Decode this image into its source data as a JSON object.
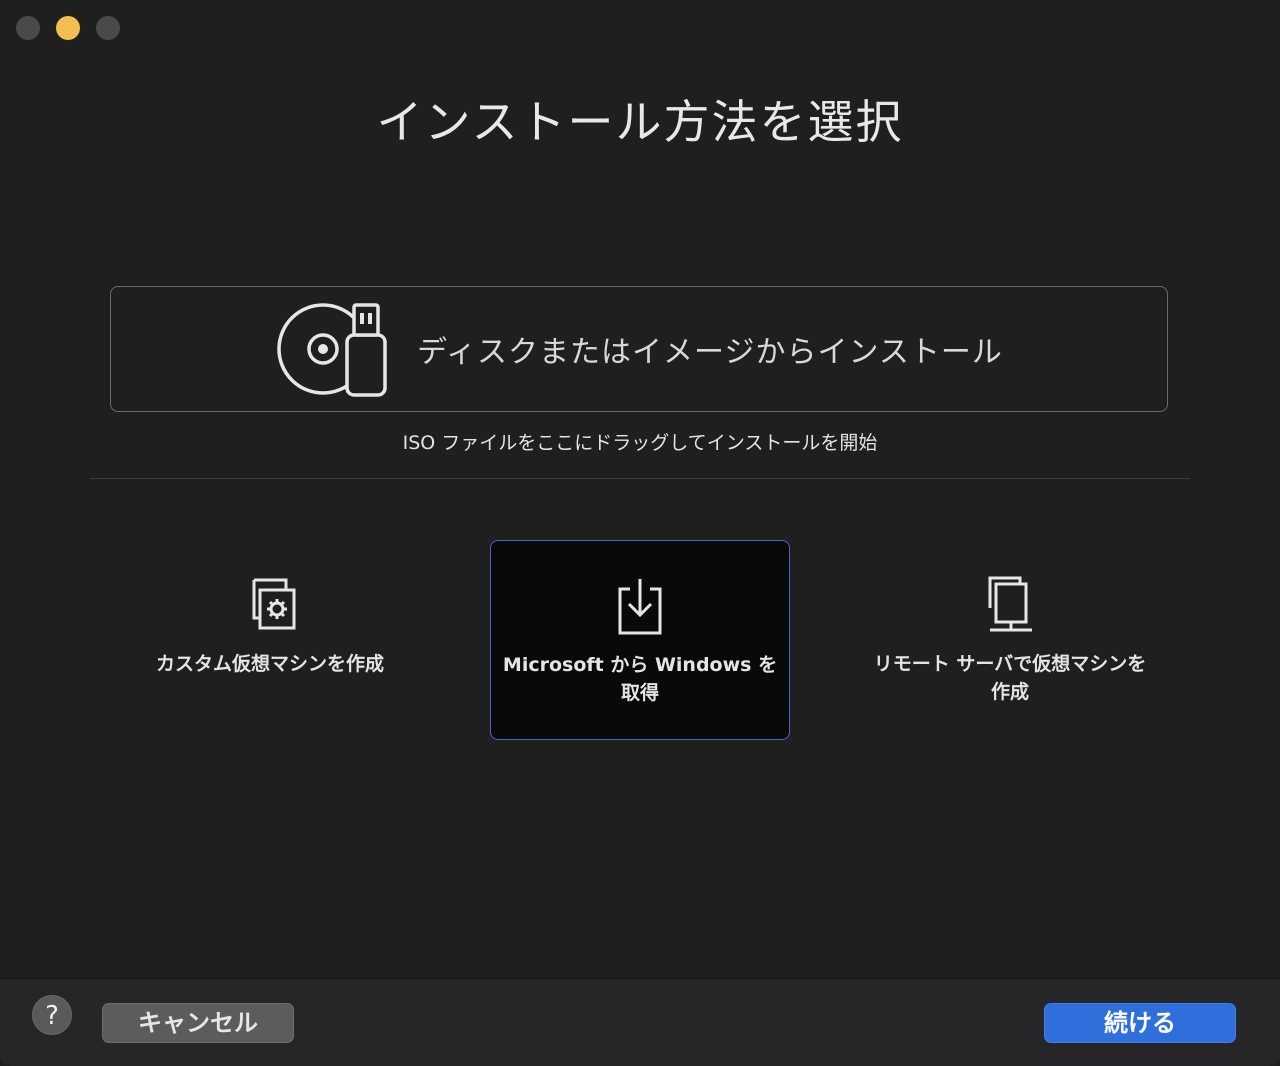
{
  "window": {
    "title": "インストール方法を選択"
  },
  "disk_option": {
    "label": "ディスクまたはイメージからインストール",
    "icon": "disk-and-usb-icon"
  },
  "hint": "ISO ファイルをここにドラッグしてインストールを開始",
  "options": [
    {
      "label": "カスタム仮想マシンを作成",
      "icon": "custom-vm-icon",
      "selected": false
    },
    {
      "label": "Microsoft から Windows を取得",
      "icon": "download-icon",
      "selected": true
    },
    {
      "label": "リモート サーバで仮想マシンを作成",
      "icon": "remote-server-icon",
      "selected": false
    }
  ],
  "footer": {
    "help_label": "?",
    "cancel_label": "キャンセル",
    "continue_label": "続ける"
  },
  "colors": {
    "background": "#1f1f20",
    "accent": "#2f6fdc",
    "selected_border": "#4a64c8",
    "traffic_minimize": "#f4bf4f"
  }
}
